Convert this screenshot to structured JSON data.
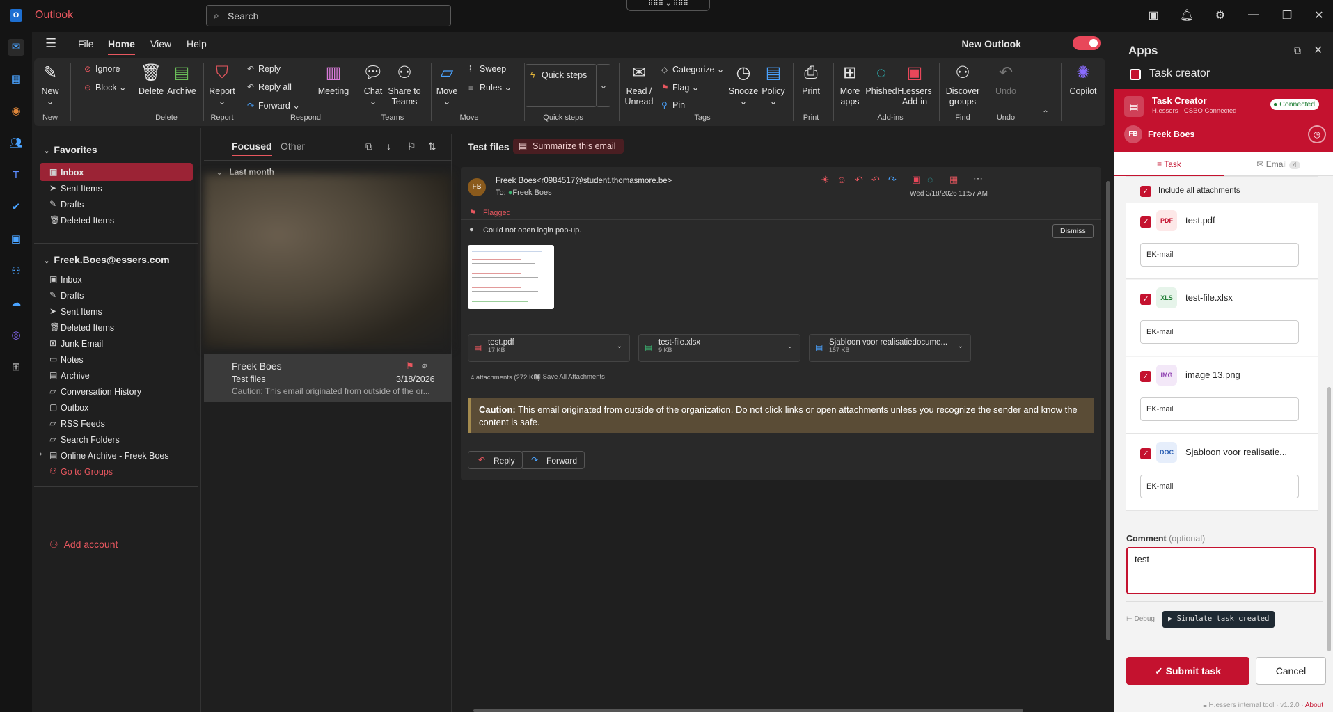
{
  "titlebar": {
    "app_name": "Outlook",
    "search_placeholder": "Search"
  },
  "menu": {
    "items": [
      "File",
      "Home",
      "View",
      "Help"
    ],
    "new_outlook_label": "New Outlook",
    "new_outlook_enabled": true
  },
  "ribbon": {
    "new_label": "New",
    "ignore_label": "Ignore",
    "block_label": "Block",
    "delete_label": "Delete",
    "archive_label": "Archive",
    "report_label": "Report",
    "reply_label": "Reply",
    "reply_all_label": "Reply all",
    "forward_label": "Forward",
    "meeting_label": "Meeting",
    "chat_label": "Chat",
    "share_teams_label": "Share to Teams",
    "move_label": "Move",
    "sweep_label": "Sweep",
    "rules_label": "Rules",
    "quick_steps_label": "Quick steps",
    "read_unread_label": "Read / Unread",
    "categorize_label": "Categorize",
    "flag_label": "Flag",
    "pin_label": "Pin",
    "snooze_label": "Snooze",
    "policy_label": "Policy",
    "print_label": "Print",
    "more_apps_label": "More apps",
    "phished_label": "Phished",
    "hessers_addin_label": "H.essers Add-in",
    "discover_groups_label": "Discover groups",
    "undo_label": "Undo",
    "copilot_label": "Copilot",
    "groups": {
      "new": "New",
      "delete": "Delete",
      "report": "Report",
      "respond": "Respond",
      "teams": "Teams",
      "move": "Move",
      "quick_steps": "Quick steps",
      "tags": "Tags",
      "print": "Print",
      "addins": "Add-ins",
      "find": "Find",
      "undo": "Undo"
    }
  },
  "folders": {
    "favorites_label": "Favorites",
    "favorites": [
      "Inbox",
      "Sent Items",
      "Drafts",
      "Deleted Items"
    ],
    "account_label": "Freek.Boes@essers.com",
    "account_items": [
      "Inbox",
      "Drafts",
      "Sent Items",
      "Deleted Items",
      "Junk Email",
      "Notes",
      "Archive",
      "Conversation History",
      "Outbox",
      "RSS Feeds",
      "Search Folders",
      "Online Archive - Freek Boes"
    ],
    "go_to_groups_label": "Go to Groups",
    "add_account_label": "Add account"
  },
  "list": {
    "tab_focused": "Focused",
    "tab_other": "Other",
    "group_label": "Last month",
    "message": {
      "sender": "Freek Boes",
      "subject": "Test files",
      "date": "3/18/2026",
      "preview": "Caution: This email originated from outside of the or..."
    }
  },
  "reading": {
    "subject": "Test files",
    "summarize_label": "Summarize this email",
    "from": "Freek Boes<r0984517@student.thomasmore.be>",
    "avatar_initials": "FB",
    "to_label": "To:",
    "to_name": "Freek Boes",
    "datetime": "Wed 3/18/2026 11:57 AM",
    "flag_status": "Flagged",
    "notice": "Could not open login pop-up.",
    "dismiss_label": "Dismiss",
    "attachments": [
      {
        "name": "test.pdf",
        "size": "17 KB",
        "icon": "pdf-icon"
      },
      {
        "name": "test-file.xlsx",
        "size": "9 KB",
        "icon": "excel-icon"
      },
      {
        "name": "Sjabloon voor realisatiedocume...",
        "size": "157 KB",
        "icon": "word-icon"
      }
    ],
    "attachments_summary": "4 attachments (272 KB)",
    "save_all_label": "Save All Attachments",
    "caution_bold": "Caution:",
    "caution_text": " This email originated from outside of the organization. Do not click links or open attachments unless you recognize the sender and know the content is safe.",
    "reply_label": "Reply",
    "forward_label": "Forward"
  },
  "pane": {
    "apps_title": "Apps",
    "addin_title": "Task creator",
    "header_title": "Task Creator",
    "header_subtitle": "H.essers · CSBO Connected",
    "status_badge": "Connected",
    "user_initials": "FB",
    "user_name": "Freek Boes",
    "tab_task": "Task",
    "tab_email": "Email",
    "email_count": "4",
    "include_all_label": "Include all attachments",
    "files": [
      {
        "type": "PDF",
        "name": "test.pdf",
        "destination": "EK-mail",
        "checked": true,
        "color": "#fde8e8",
        "text_color": "#c4122f"
      },
      {
        "type": "XLS",
        "name": "test-file.xlsx",
        "destination": "EK-mail",
        "checked": true,
        "color": "#e6f4ea",
        "text_color": "#1e7e34"
      },
      {
        "type": "IMG",
        "name": "image 13.png",
        "destination": "EK-mail",
        "checked": true,
        "color": "#f3e8f8",
        "text_color": "#8e3fb0"
      },
      {
        "type": "DOC",
        "name": "Sjabloon voor realisatie...",
        "destination": "EK-mail",
        "checked": true,
        "color": "#e6eefb",
        "text_color": "#2b5fb4"
      }
    ],
    "comment_label": "Comment",
    "comment_optional": "(optional)",
    "comment_value": "test",
    "debug_label": "Debug",
    "simulate_label": "Simulate task created",
    "submit_label": "Submit task",
    "cancel_label": "Cancel",
    "footer_text": "H.essers internal tool · v1.2.0 · ",
    "about_label": "About"
  },
  "colors": {
    "accent": "#e8575f",
    "brand_red": "#c4122f"
  }
}
